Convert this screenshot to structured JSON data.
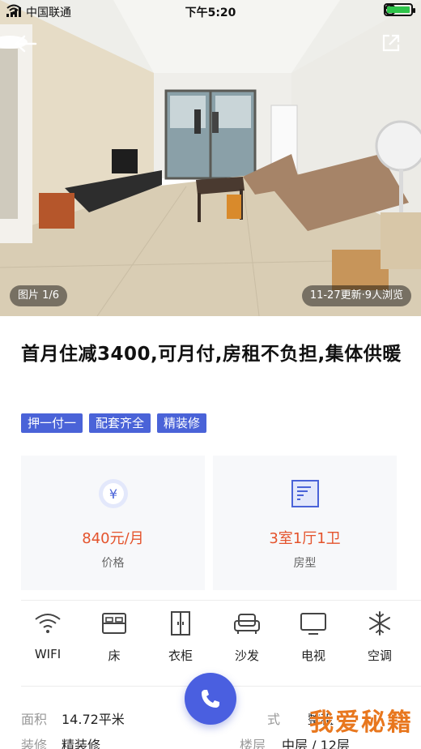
{
  "status_bar": {
    "carrier": "中国联通",
    "time": "下午5:20"
  },
  "hero": {
    "photo_counter": "图片 1/6",
    "meta": "11-27更新·9人浏览"
  },
  "listing": {
    "title": "首月住减3400,可月付,房租不负担,集体供暖",
    "tags": [
      "押一付一",
      "配套齐全",
      "精装修"
    ]
  },
  "summary": {
    "price_value": "840元/月",
    "price_label": "价格",
    "layout_value": "3室1厅1卫",
    "layout_label": "房型"
  },
  "amenities": [
    {
      "label": "WIFI",
      "icon": "wifi-icon"
    },
    {
      "label": "床",
      "icon": "bed-icon"
    },
    {
      "label": "衣柜",
      "icon": "wardrobe-icon"
    },
    {
      "label": "沙发",
      "icon": "sofa-icon"
    },
    {
      "label": "电视",
      "icon": "tv-icon"
    },
    {
      "label": "空调",
      "icon": "snowflake-icon"
    }
  ],
  "details": {
    "area_key": "面积",
    "area_value": "14.72平米",
    "rent_type_key": "式",
    "rent_type_value": "整租",
    "decoration_key": "装修",
    "decoration_value": "精装修",
    "floor_key": "楼层",
    "floor_value": "中层 / 12层"
  },
  "watermark": "我爱秘籍",
  "colors": {
    "accent": "#4a63d8",
    "price": "#e4532c",
    "call": "#4a5fe0"
  }
}
